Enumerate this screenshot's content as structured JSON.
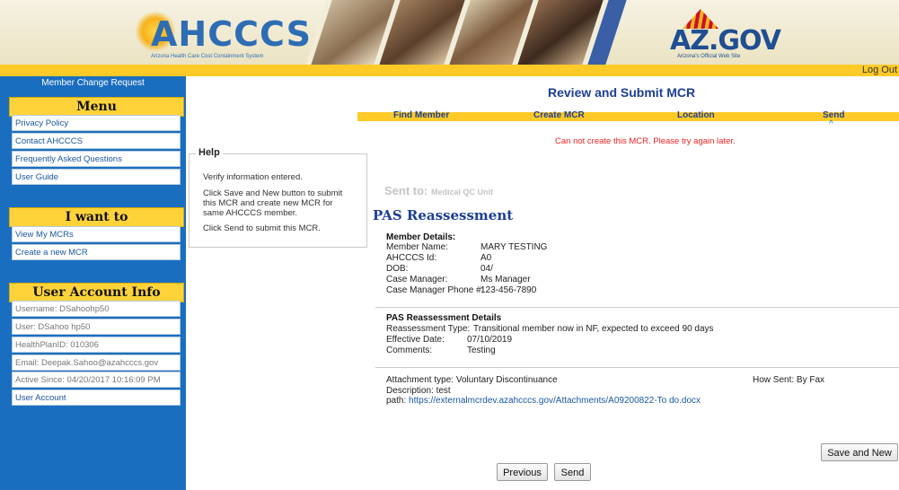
{
  "banner": {
    "logo_text": "AHCCCS",
    "logo_subtitle": "Arizona Health Care Cost Containment System",
    "azgov_text": "AZ.GOV",
    "azgov_subtitle": "Arizona's Official Web Site"
  },
  "header": {
    "logout": "Log Out"
  },
  "sidebar": {
    "title": "Member Change Request",
    "menu_heading": "Menu",
    "menu_items": [
      {
        "label": "Privacy Policy"
      },
      {
        "label": "Contact AHCCCS"
      },
      {
        "label": "Frequently Asked Questions"
      },
      {
        "label": "User Guide"
      }
    ],
    "iwant_heading": "I want to",
    "iwant_items": [
      {
        "label": "View My MCRs"
      },
      {
        "label": "Create a new MCR"
      }
    ],
    "account_heading": "User Account Info",
    "account_items": [
      {
        "label": "Username: DSahoohp50"
      },
      {
        "label": "User: DSahoo hp50"
      },
      {
        "label": "HealthPlanID: 010306"
      },
      {
        "label": "Email: Deepak.Sahoo@azahcccs.gov"
      },
      {
        "label": "Active Since: 04/20/2017 10:16:09 PM"
      },
      {
        "label": "User Account"
      }
    ]
  },
  "main": {
    "title": "Review and Submit MCR",
    "steps": [
      "Find Member",
      "Create MCR",
      "Location",
      "Send"
    ],
    "active_step_marker": "^",
    "error": "Can not create this MCR. Please try again later.",
    "sent_to_label": "Sent to:",
    "sent_to_value": "Medical QC Unit",
    "pas_title": "PAS Reassessment",
    "member_details_heading": "Member Details:",
    "member_details": [
      {
        "label": "Member Name:",
        "value": "MARY TESTING"
      },
      {
        "label": "AHCCCS Id:",
        "value": "A0"
      },
      {
        "label": "DOB:",
        "value": "04/"
      },
      {
        "label": "Case Manager:",
        "value": "Ms Manager"
      },
      {
        "label": "Case Manager Phone #:",
        "value": "123-456-7890"
      }
    ],
    "pas_details_heading": "PAS Reassessment Details",
    "pas_details": [
      {
        "label": "Reassessment Type:",
        "value": "Transitional member now in NF, expected to exceed 90 days"
      },
      {
        "label": "Effective Date:",
        "value": "07/10/2019"
      },
      {
        "label": "Comments:",
        "value": "Testing"
      }
    ],
    "attachment": {
      "type_label": "Attachment type:",
      "type_value": "Voluntary Discontinuance",
      "how_sent_label": "How Sent:",
      "how_sent_value": "By Fax",
      "description_label": "Description:",
      "description_value": "test",
      "path_label": "path:",
      "path_value": "https://externalmcrdev.azahcccs.gov/Attachments/A09200822-To do.docx"
    },
    "buttons": {
      "save_and_new": "Save and New",
      "previous": "Previous",
      "send": "Send"
    }
  },
  "help": {
    "title": "Help",
    "lines": [
      "Verify information entered.",
      "Click Save and New button to submit this MCR and create new MCR for same AHCCCS member.",
      "Click Send to submit this MCR."
    ]
  },
  "colors": {
    "sidebar_blue": "#1a6ec0",
    "gold": "#fdca28",
    "title_blue": "#1c3e96",
    "error_red": "#e22222"
  }
}
